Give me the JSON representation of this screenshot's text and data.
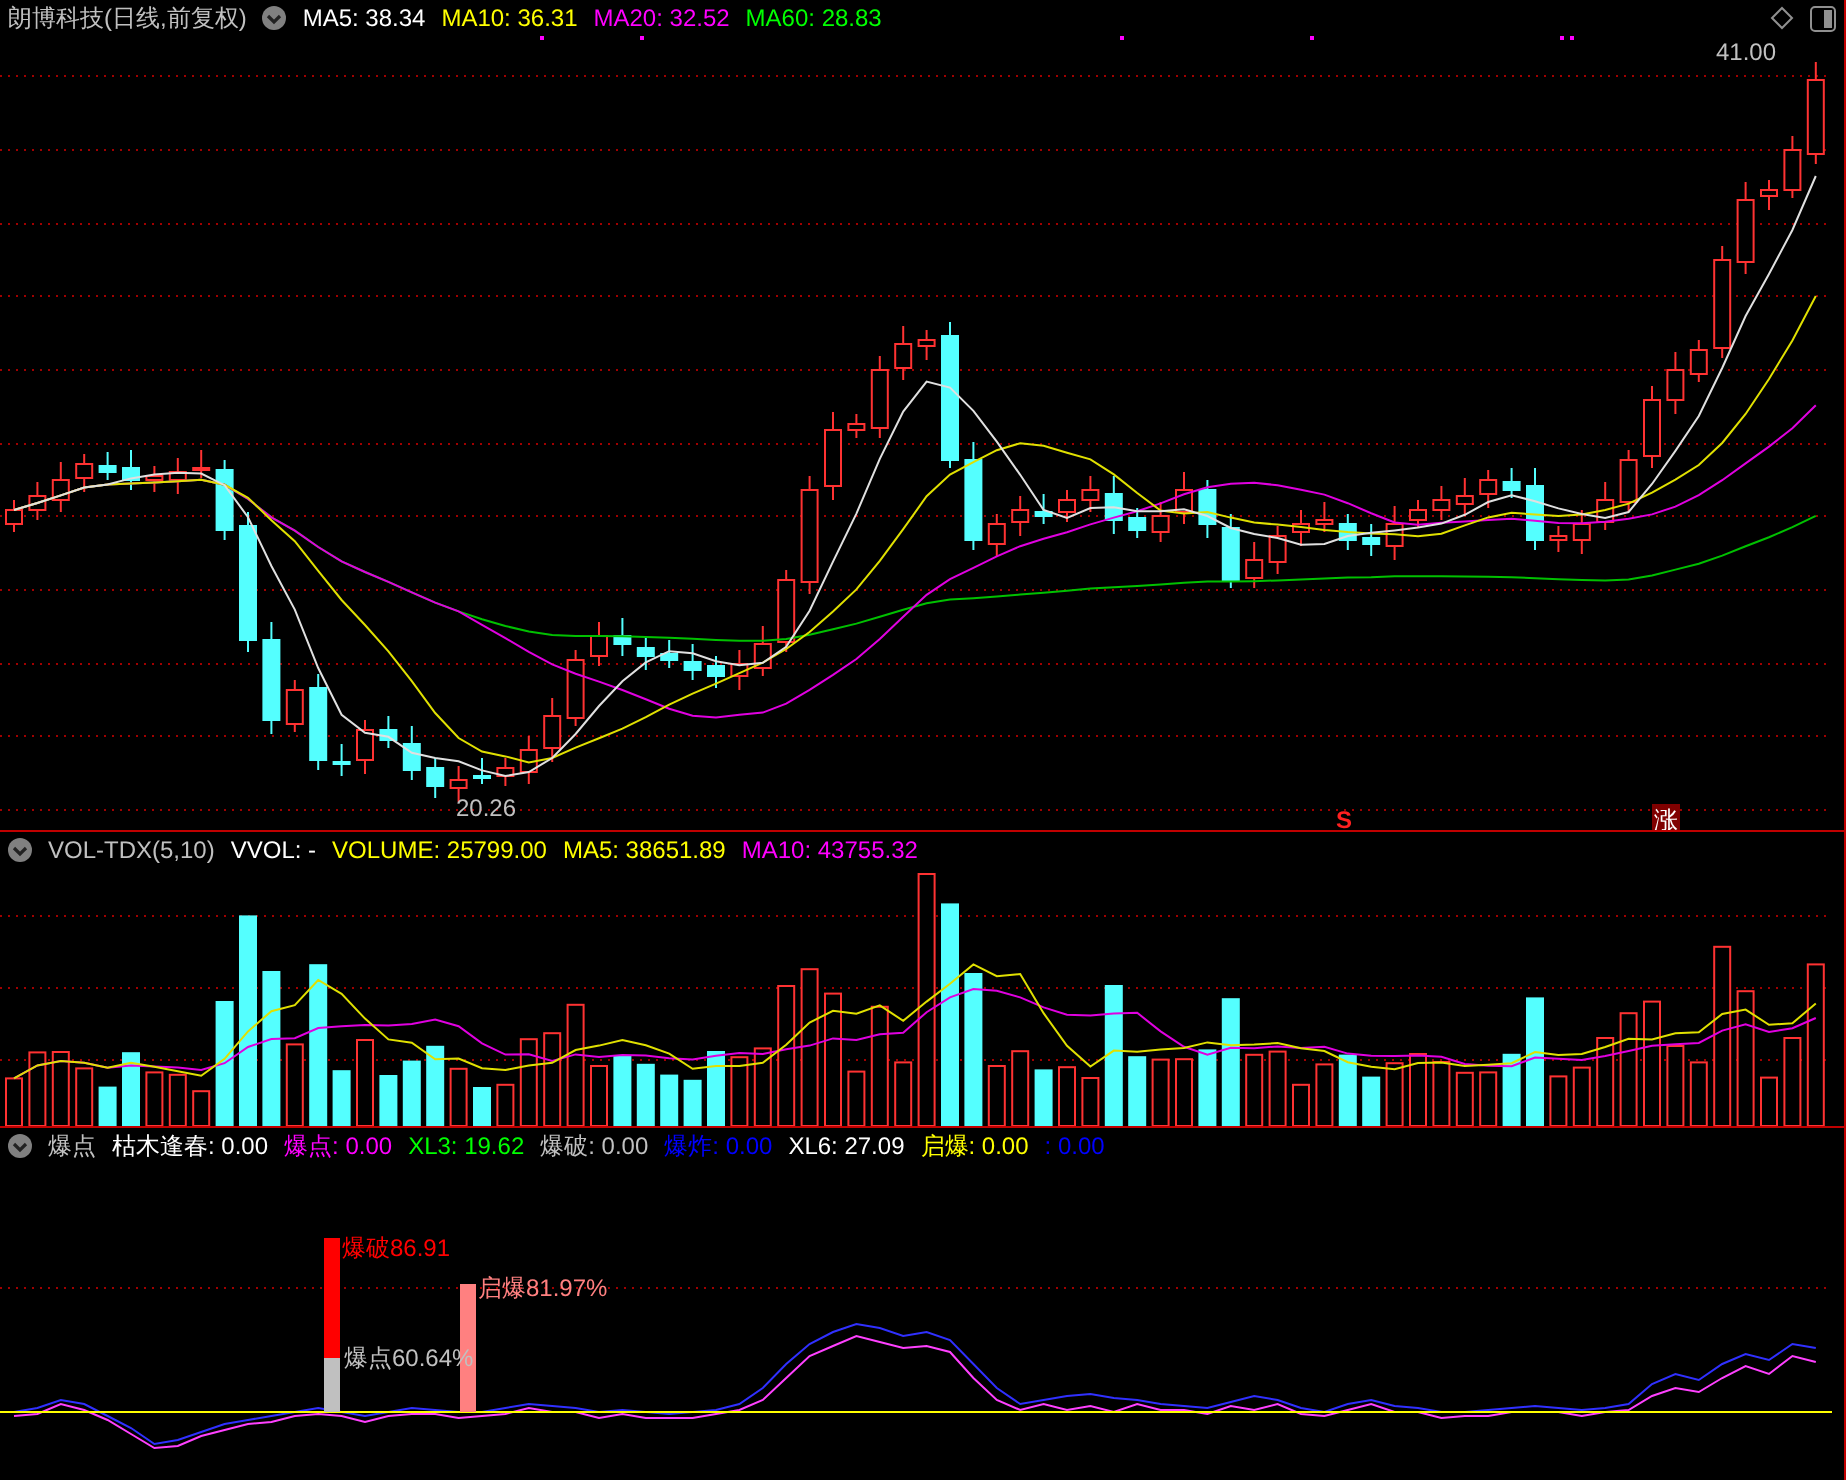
{
  "title": "朗博科技(日线,前复权)",
  "main": {
    "legend": [
      {
        "label": "MA5: 38.34",
        "color": "#ffffff"
      },
      {
        "label": "MA10: 36.31",
        "color": "#ffff00"
      },
      {
        "label": "MA20: 32.52",
        "color": "#ff00ff"
      },
      {
        "label": "MA60: 28.83",
        "color": "#00ff00"
      }
    ],
    "high_label": "41.00",
    "low_label": "20.26",
    "markers": [
      {
        "kind": "signal",
        "text": "S"
      },
      {
        "kind": "tag",
        "text": "涨"
      }
    ]
  },
  "volume": {
    "name": "VOL-TDX(5,10)",
    "legend": [
      {
        "label": "VVOL: -",
        "color": "#ffffff"
      },
      {
        "label": "VOLUME: 25799.00",
        "color": "#ffff00"
      },
      {
        "label": "MA5: 38651.89",
        "color": "#ffff00"
      },
      {
        "label": "MA10: 43755.32",
        "color": "#ff00ff"
      }
    ]
  },
  "indicator": {
    "name": "爆点",
    "legend": [
      {
        "label": "枯木逢春: 0.00",
        "color": "#ffffff"
      },
      {
        "label": "爆点: 0.00",
        "color": "#ff00ff"
      },
      {
        "label": "XL3: 19.62",
        "color": "#00ff00"
      },
      {
        "label": "爆破: 0.00",
        "color": "#c0c0c0"
      },
      {
        "label": "爆炸: 0.00",
        "color": "#0000ff"
      },
      {
        "label": "XL6: 27.09",
        "color": "#ffffff"
      },
      {
        "label": "启爆: 0.00",
        "color": "#ffff00"
      },
      {
        "label": ": 0.00",
        "color": "#0000ff"
      }
    ],
    "annotations": [
      {
        "text": "爆破86.91",
        "color": "#ff0000"
      },
      {
        "text": "启爆81.97%",
        "color": "#ff8080"
      },
      {
        "text": "爆点60.64%",
        "color": "#c0c0c0"
      }
    ]
  }
}
